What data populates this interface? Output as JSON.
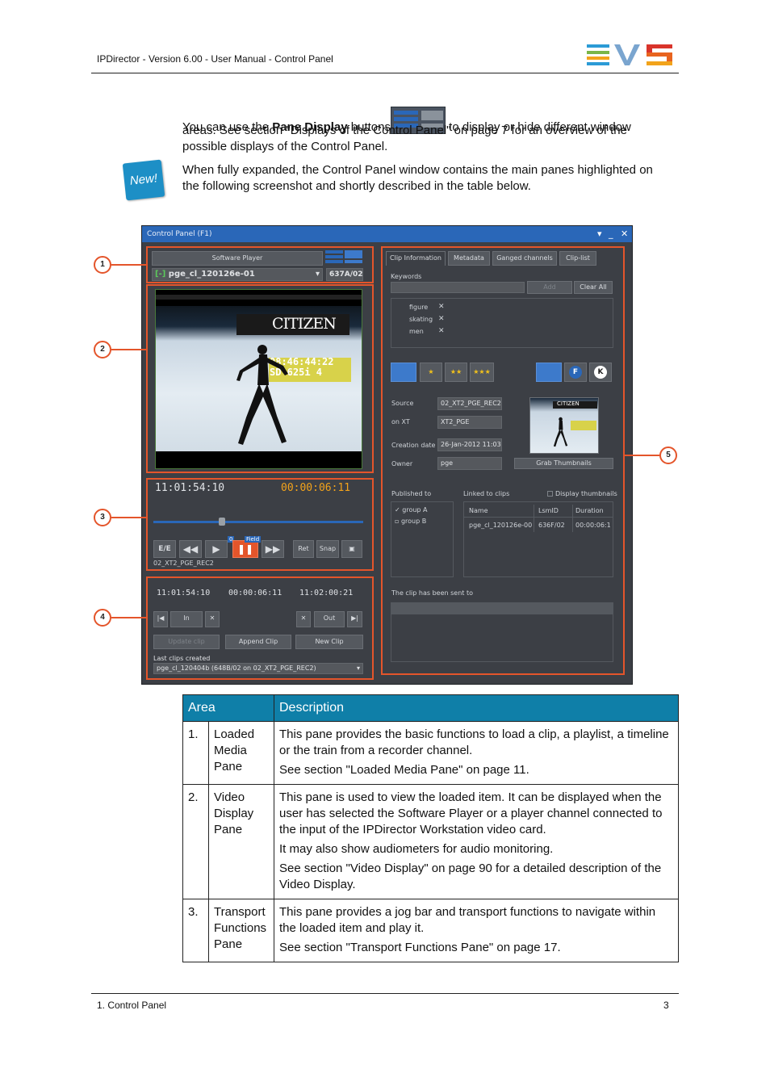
{
  "header": {
    "title": "IPDirector - Version 6.00 - User Manual - Control Panel",
    "logo_text": "EVS"
  },
  "intro": {
    "line1_pre": "You can use the ",
    "line1_bold": "Pane Display",
    "line1_mid": " buttons",
    "line1_post": " to display or hide different window",
    "line2": "areas. See section \"Displays of the Control Panel\" on page 7 for an overview of the",
    "line3": "possible displays of the Control Panel.",
    "new_badge": "New!",
    "note_line1": "When fully expanded, the Control Panel window contains the main panes highlighted on",
    "note_line2": "the following screenshot and shortly described in the table below."
  },
  "screenshot": {
    "window_title": "Control Panel (F1)",
    "software_player": "Software Player",
    "clip_name": "pge_cl_120126e-01",
    "clip_id": "637A/02",
    "tc_left": "11:01:54:10",
    "tc_right": "00:00:06:11",
    "transport": {
      "ee": "E/E",
      "field": "Field",
      "zero": "0",
      "ret": "Ret",
      "snap": "Snap",
      "channel": "02_XT2_PGE_REC2"
    },
    "in_tc": "11:01:54:10",
    "dur_tc": "00:00:06:11",
    "out_tc": "11:02:00:21",
    "in_label": "In",
    "out_label": "Out",
    "update_clip": "Update clip",
    "append_clip": "Append Clip",
    "new_clip": "New Clip",
    "last_clips_label": "Last clips created",
    "last_clip_value": "pge_cl_120404b (648B/02 on 02_XT2_PGE_REC2)",
    "tabs": [
      "Clip Information",
      "Metadata",
      "Ganged channels",
      "Clip-list"
    ],
    "keywords_label": "Keywords",
    "add": "Add",
    "clear_all": "Clear All",
    "keywords": [
      "figure",
      "skating",
      "men"
    ],
    "ratings": [
      "★",
      "★★",
      "★★★"
    ],
    "f_btn": "F",
    "k_btn": "K",
    "fields": [
      {
        "label": "Source",
        "value": "02_XT2_PGE_REC2"
      },
      {
        "label": "on XT",
        "value": "XT2_PGE"
      },
      {
        "label": "Creation date",
        "value": "26-Jan-2012 11:03:1"
      },
      {
        "label": "Owner",
        "value": "pge"
      }
    ],
    "grab_thumbnails": "Grab Thumbnails",
    "published_to": "Published to",
    "linked_to_clips": "Linked to clips",
    "display_thumbnails": "Display thumbnails",
    "groups": [
      "group A",
      "group B"
    ],
    "linked_headers": [
      "Name",
      "LsmID",
      "Duration"
    ],
    "linked_row": [
      "pge_cl_120126e-00",
      "636F/02",
      "00:00:06:1"
    ],
    "sent_to": "The clip has been sent to",
    "video_overlay_brand": "CITIZEN",
    "video_overlay_tc1": "08:46:44:22",
    "video_overlay_tc2": "SD 625i  4",
    "thumb_brand": "CITIZEN"
  },
  "callouts": [
    "1",
    "2",
    "3",
    "4",
    "5"
  ],
  "table": {
    "headers": [
      "Area",
      "Description"
    ],
    "rows": [
      {
        "num": "1.",
        "area": [
          "Loaded",
          "Media",
          "Pane"
        ],
        "desc": [
          "This pane provides the basic functions to load a clip, a playlist, a timeline or the train from a recorder channel.",
          "See section \"Loaded Media Pane\" on page 11."
        ]
      },
      {
        "num": "2.",
        "area": [
          "Video",
          "Display",
          "Pane"
        ],
        "desc": [
          "This pane is used to view the loaded item. It can be displayed when the user has selected the Software Player or a player channel connected to the input of the IPDirector Workstation video card.",
          "It may also show audiometers for audio monitoring.",
          "See section \"Video Display\" on page 90 for a detailed description of the Video Display."
        ]
      },
      {
        "num": "3.",
        "area": [
          "Transport",
          "Functions",
          "Pane"
        ],
        "desc": [
          "This pane provides a jog bar and transport functions to navigate within the loaded item and play it.",
          "See section \"Transport Functions Pane\" on page 17."
        ]
      }
    ]
  },
  "footer": {
    "left": "1. Control Panel",
    "right": "3"
  },
  "colors": {
    "accent_orange": "#e4552b",
    "table_header": "#0f7fa8",
    "title_bar": "#2a67b8"
  }
}
